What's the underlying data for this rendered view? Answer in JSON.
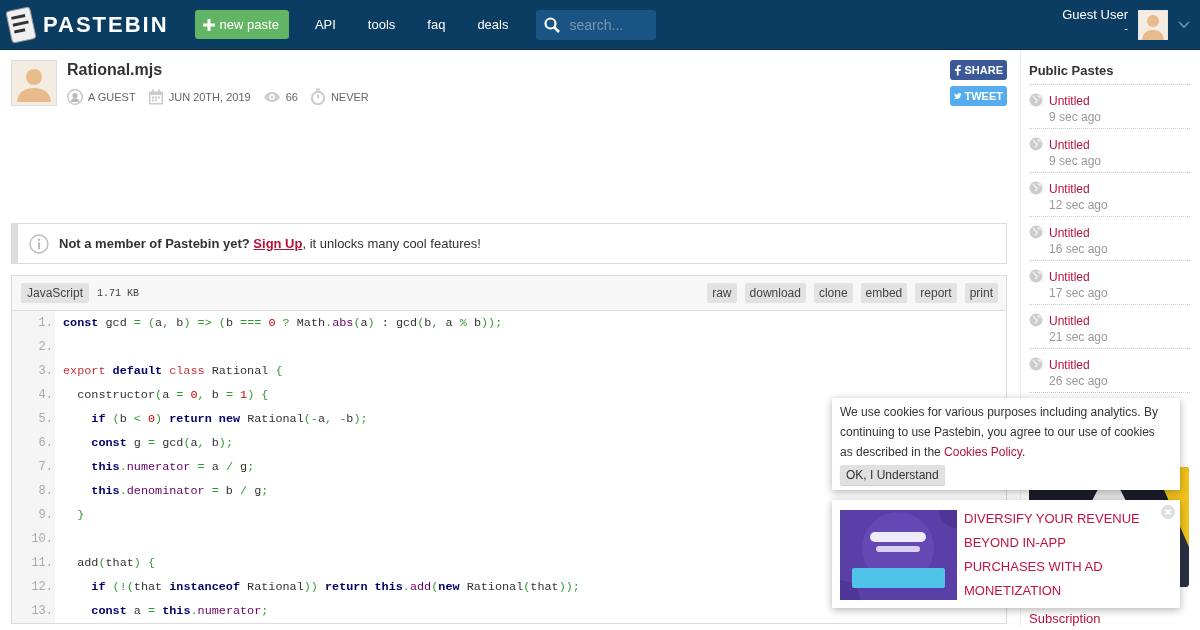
{
  "header": {
    "logo_text": "PASTEBIN",
    "new_paste": "new paste",
    "nav": [
      "API",
      "tools",
      "faq",
      "deals"
    ],
    "search_placeholder": "search...",
    "user_name": "Guest User",
    "user_sub": "-"
  },
  "paste": {
    "title": "Rational.mjs",
    "meta": [
      {
        "kind": "user",
        "text": "A GUEST"
      },
      {
        "kind": "date",
        "text": "JUN 20TH, 2019"
      },
      {
        "kind": "views",
        "text": "66"
      },
      {
        "kind": "expiry",
        "text": "NEVER"
      }
    ],
    "share": [
      {
        "kind": "facebook",
        "label": "SHARE"
      },
      {
        "kind": "twitter",
        "label": "TWEET"
      }
    ]
  },
  "notice": {
    "lead": "**Not a member of Pastebin yet?**",
    "link": "Sign Up",
    "rest": ", it unlocks many cool features!"
  },
  "code": {
    "language": "JavaScript",
    "size": "1.71 KB",
    "actions": [
      "raw",
      "download",
      "clone",
      "embed",
      "report",
      "print"
    ],
    "lines": [
      {
        "n": "1.",
        "tokens": [
          {
            "kind": "keyword",
            "text": "const"
          },
          {
            "kind": "plain",
            "text": " gcd "
          },
          {
            "kind": "operator",
            "text": "= ("
          },
          {
            "kind": "plain",
            "text": "a"
          },
          {
            "kind": "operator",
            "text": ","
          },
          {
            "kind": "plain",
            "text": " b"
          },
          {
            "kind": "operator",
            "text": ") => ("
          },
          {
            "kind": "plain",
            "text": "b "
          },
          {
            "kind": "operator",
            "text": "=== "
          },
          {
            "kind": "number",
            "text": "0"
          },
          {
            "kind": "operator",
            "text": " ?"
          },
          {
            "kind": "plain",
            "text": " Math"
          },
          {
            "kind": "operator",
            "text": "."
          },
          {
            "kind": "property",
            "text": "abs"
          },
          {
            "kind": "operator",
            "text": "("
          },
          {
            "kind": "plain",
            "text": "a"
          },
          {
            "kind": "operator",
            "text": ")"
          },
          {
            "kind": "plain",
            "text": " : gcd"
          },
          {
            "kind": "operator",
            "text": "("
          },
          {
            "kind": "plain",
            "text": "b"
          },
          {
            "kind": "operator",
            "text": ","
          },
          {
            "kind": "plain",
            "text": " a "
          },
          {
            "kind": "operator",
            "text": "%"
          },
          {
            "kind": "plain",
            "text": " b"
          },
          {
            "kind": "operator",
            "text": "));"
          }
        ]
      },
      {
        "n": "2."
      },
      {
        "n": "3.",
        "tokens": [
          {
            "kind": "declaration",
            "text": "export "
          },
          {
            "kind": "keyword",
            "text": "default "
          },
          {
            "kind": "declaration",
            "text": "class"
          },
          {
            "kind": "plain",
            "text": " Rational "
          },
          {
            "kind": "operator",
            "text": "{"
          }
        ]
      },
      {
        "n": "4.",
        "tokens": [
          {
            "kind": "plain",
            "text": "  constructor"
          },
          {
            "kind": "operator",
            "text": "("
          },
          {
            "kind": "plain",
            "text": "a "
          },
          {
            "kind": "operator",
            "text": "= "
          },
          {
            "kind": "number",
            "text": "0"
          },
          {
            "kind": "operator",
            "text": ", "
          },
          {
            "kind": "plain",
            "text": "b "
          },
          {
            "kind": "operator",
            "text": "= "
          },
          {
            "kind": "number",
            "text": "1"
          },
          {
            "kind": "operator",
            "text": ") {"
          }
        ]
      },
      {
        "n": "5.",
        "tokens": [
          {
            "kind": "keyword",
            "text": "    if"
          },
          {
            "kind": "operator",
            "text": " ("
          },
          {
            "kind": "plain",
            "text": "b "
          },
          {
            "kind": "operator",
            "text": "< "
          },
          {
            "kind": "number",
            "text": "0"
          },
          {
            "kind": "operator",
            "text": ") "
          },
          {
            "kind": "keyword",
            "text": "return new"
          },
          {
            "kind": "plain",
            "text": " Rational"
          },
          {
            "kind": "operator",
            "text": "(-"
          },
          {
            "kind": "plain",
            "text": "a"
          },
          {
            "kind": "operator",
            "text": ", -"
          },
          {
            "kind": "plain",
            "text": "b"
          },
          {
            "kind": "operator",
            "text": ");"
          }
        ]
      },
      {
        "n": "6.",
        "tokens": [
          {
            "kind": "keyword",
            "text": "    const"
          },
          {
            "kind": "plain",
            "text": " g "
          },
          {
            "kind": "operator",
            "text": "= "
          },
          {
            "kind": "plain",
            "text": "gcd"
          },
          {
            "kind": "operator",
            "text": "("
          },
          {
            "kind": "plain",
            "text": "a"
          },
          {
            "kind": "operator",
            "text": ", "
          },
          {
            "kind": "plain",
            "text": "b"
          },
          {
            "kind": "operator",
            "text": ");"
          }
        ]
      },
      {
        "n": "7.",
        "tokens": [
          {
            "kind": "keyword",
            "text": "    this"
          },
          {
            "kind": "operator",
            "text": "."
          },
          {
            "kind": "property",
            "text": "numerator"
          },
          {
            "kind": "operator",
            "text": " = "
          },
          {
            "kind": "plain",
            "text": "a "
          },
          {
            "kind": "operator",
            "text": "/ "
          },
          {
            "kind": "plain",
            "text": "g"
          },
          {
            "kind": "operator",
            "text": ";"
          }
        ]
      },
      {
        "n": "8.",
        "tokens": [
          {
            "kind": "keyword",
            "text": "    this"
          },
          {
            "kind": "operator",
            "text": "."
          },
          {
            "kind": "property",
            "text": "denominator"
          },
          {
            "kind": "operator",
            "text": " = "
          },
          {
            "kind": "plain",
            "text": "b "
          },
          {
            "kind": "operator",
            "text": "/ "
          },
          {
            "kind": "plain",
            "text": "g"
          },
          {
            "kind": "operator",
            "text": ";"
          }
        ]
      },
      {
        "n": "9.",
        "tokens": [
          {
            "kind": "operator",
            "text": "  }"
          }
        ]
      },
      {
        "n": "10."
      },
      {
        "n": "11.",
        "tokens": [
          {
            "kind": "plain",
            "text": "  add"
          },
          {
            "kind": "operator",
            "text": "("
          },
          {
            "kind": "plain",
            "text": "that"
          },
          {
            "kind": "operator",
            "text": ") {"
          }
        ]
      },
      {
        "n": "12.",
        "tokens": [
          {
            "kind": "keyword",
            "text": "    if"
          },
          {
            "kind": "operator",
            "text": " (!("
          },
          {
            "kind": "plain",
            "text": "that "
          },
          {
            "kind": "keyword",
            "text": "instanceof"
          },
          {
            "kind": "plain",
            "text": " Rational"
          },
          {
            "kind": "operator",
            "text": ")) "
          },
          {
            "kind": "keyword",
            "text": "return this"
          },
          {
            "kind": "operator",
            "text": "."
          },
          {
            "kind": "property",
            "text": "add"
          },
          {
            "kind": "operator",
            "text": "("
          },
          {
            "kind": "keyword",
            "text": "new"
          },
          {
            "kind": "plain",
            "text": " Rational"
          },
          {
            "kind": "operator",
            "text": "("
          },
          {
            "kind": "plain",
            "text": "that"
          },
          {
            "kind": "operator",
            "text": "));"
          }
        ]
      },
      {
        "n": "13.",
        "tokens": [
          {
            "kind": "keyword",
            "text": "    const"
          },
          {
            "kind": "plain",
            "text": " a "
          },
          {
            "kind": "operator",
            "text": "= "
          },
          {
            "kind": "keyword",
            "text": "this"
          },
          {
            "kind": "operator",
            "text": "."
          },
          {
            "kind": "property",
            "text": "numerator"
          },
          {
            "kind": "operator",
            "text": ";"
          }
        ]
      }
    ]
  },
  "sidebar": {
    "title": "Public Pastes",
    "pastes": [
      {
        "title": "Untitled",
        "time": "9 sec ago"
      },
      {
        "title": "Untitled",
        "time": "9 sec ago"
      },
      {
        "title": "Untitled",
        "time": "12 sec ago"
      },
      {
        "title": "Untitled",
        "time": "16 sec ago"
      },
      {
        "title": "Untitled",
        "time": "17 sec ago"
      },
      {
        "title": "Untitled",
        "time": "21 sec ago"
      },
      {
        "title": "Untitled",
        "time": "26 sec ago"
      }
    ],
    "link": "Subscription"
  },
  "cookie": {
    "text": "We use cookies for various purposes including analytics. By continuing to use Pastebin, you agree to our use of cookies as described in the",
    "link": "Cookies Policy",
    "after": ".",
    "button": "OK, I Understand"
  },
  "ad_popup": {
    "kind": "picture",
    "headline": "DIVERSIFY YOUR REVENUE BEYOND IN-APP PURCHASES WITH AD MONETIZATION"
  }
}
